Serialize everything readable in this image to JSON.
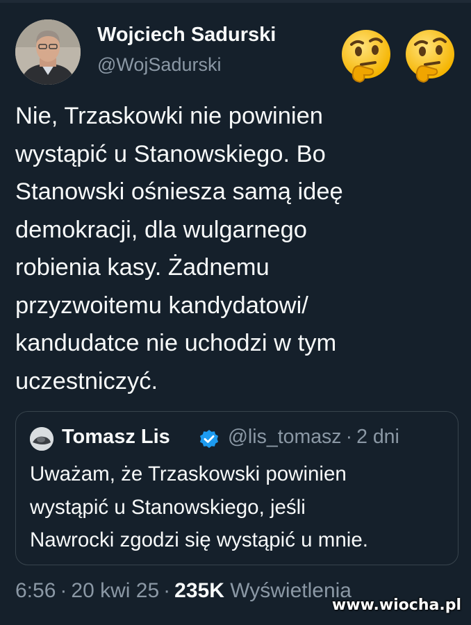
{
  "author": {
    "name": "Wojciech Sadurski",
    "handle": "@WojSadurski"
  },
  "header_emojis": [
    "thinking-face",
    "thinking-face"
  ],
  "tweet": {
    "lines": [
      "Nie, Trzaskowki nie powinien",
      "wystąpić u Stanowskiego. Bo",
      "Stanowski ośniesza samą ideę",
      "demokracji, dla wulgarnego",
      "robienia kasy. Żadnemu",
      "przyzwoitemu kandydatowi/",
      "kandudatce nie uchodzi w tym",
      "uczestniczyć."
    ]
  },
  "quote": {
    "name": "Tomasz Lis",
    "handle": "@lis_tomasz",
    "separator": "·",
    "time": "2 dni",
    "lines": [
      "Uważam, że Trzaskowski powinien",
      "wystąpić u Stanowskiego, jeśli",
      "Nawrocki zgodzi się wystąpić u mnie."
    ]
  },
  "footer": {
    "time": "6:56",
    "separator": "·",
    "date": "20 kwi 25",
    "views_count": "235K",
    "views_label": "Wyświetlenia"
  },
  "watermark": "www.wiocha.pl",
  "colors": {
    "background": "#15202b",
    "text": "#f7f9f9",
    "secondary": "#8b98a5",
    "border": "#38444d",
    "verified": "#1d9bf0"
  }
}
